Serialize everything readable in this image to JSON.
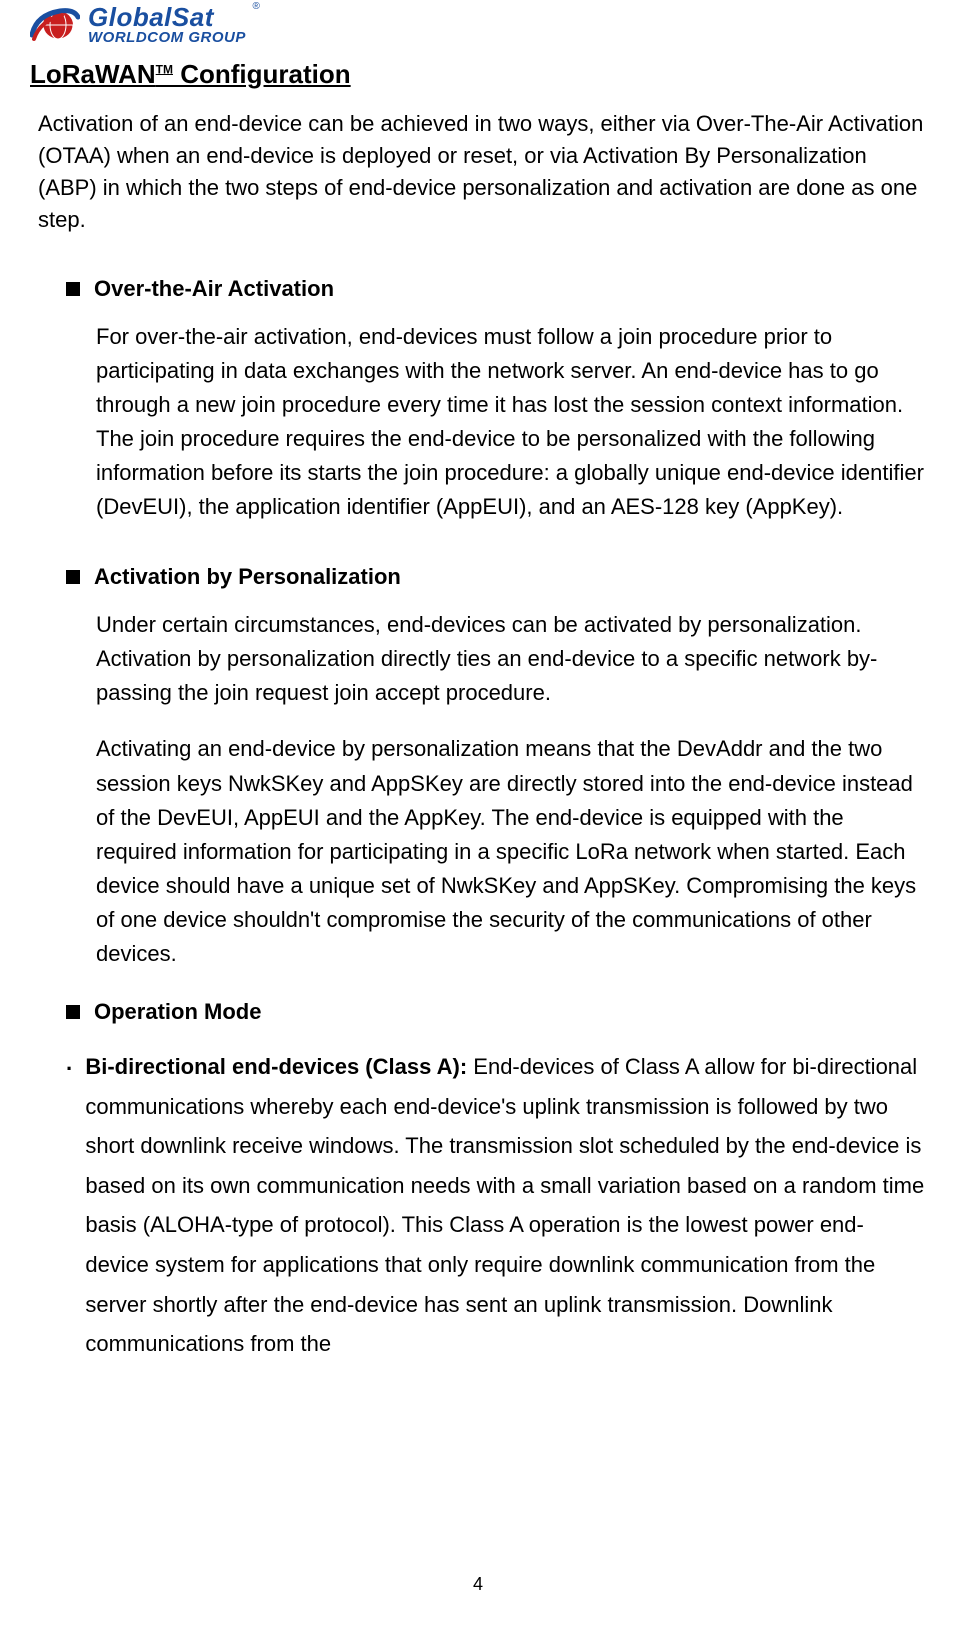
{
  "logo": {
    "line1": "GlobalSat",
    "line2": "WORLDCOM GROUP",
    "reg": "®"
  },
  "title": {
    "main": "LoRaWAN",
    "sup": "TM",
    "tail": " Configuration"
  },
  "intro": "Activation of an end-device can be achieved in two ways, either via Over-The-Air Activation (OTAA) when an end-device is deployed or reset, or via Activation By Personalization (ABP) in which the two steps of end-device personalization and activation are done as one step.",
  "sections": {
    "otaa": {
      "heading": "Over-the-Air Activation",
      "body": "For over-the-air activation, end-devices must follow a join procedure prior to participating in data exchanges with the network server. An end-device has to go through a new join procedure every time it has lost the session context information. The join procedure requires the end-device to be personalized with the following information before its starts the join procedure: a globally unique end-device identifier (DevEUI), the application identifier (AppEUI), and an AES-128 key (AppKey)."
    },
    "abp": {
      "heading": "Activation by Personalization",
      "body1": "Under certain circumstances, end-devices can be activated by personalization. Activation by personalization directly ties an end-device to a specific network by-passing the join request join accept procedure.",
      "body2": "Activating an end-device by personalization means that the DevAddr and the two session keys NwkSKey and AppSKey are directly stored into the end-device instead of the DevEUI, AppEUI and the AppKey. The end-device is equipped with the required information for participating in a specific LoRa network when started. Each device should have a unique set of NwkSKey and AppSKey. Compromising the keys of one device shouldn't compromise the security of the communications of other devices."
    },
    "opmode": {
      "heading": "Operation Mode",
      "classA": {
        "label": "Bi-directional end-devices (Class A): ",
        "body": "End-devices of Class A allow for bi-directional communications whereby each end-device's uplink transmission is followed by two short downlink receive windows. The transmission slot scheduled by the end-device is based on its own communication needs with a small variation based on a random time basis (ALOHA-type of protocol). This Class A operation is the lowest power end-device system for applications that only require downlink communication from the server shortly after the end-device has sent an uplink transmission. Downlink communications from the"
      }
    }
  },
  "pageNumber": "4"
}
